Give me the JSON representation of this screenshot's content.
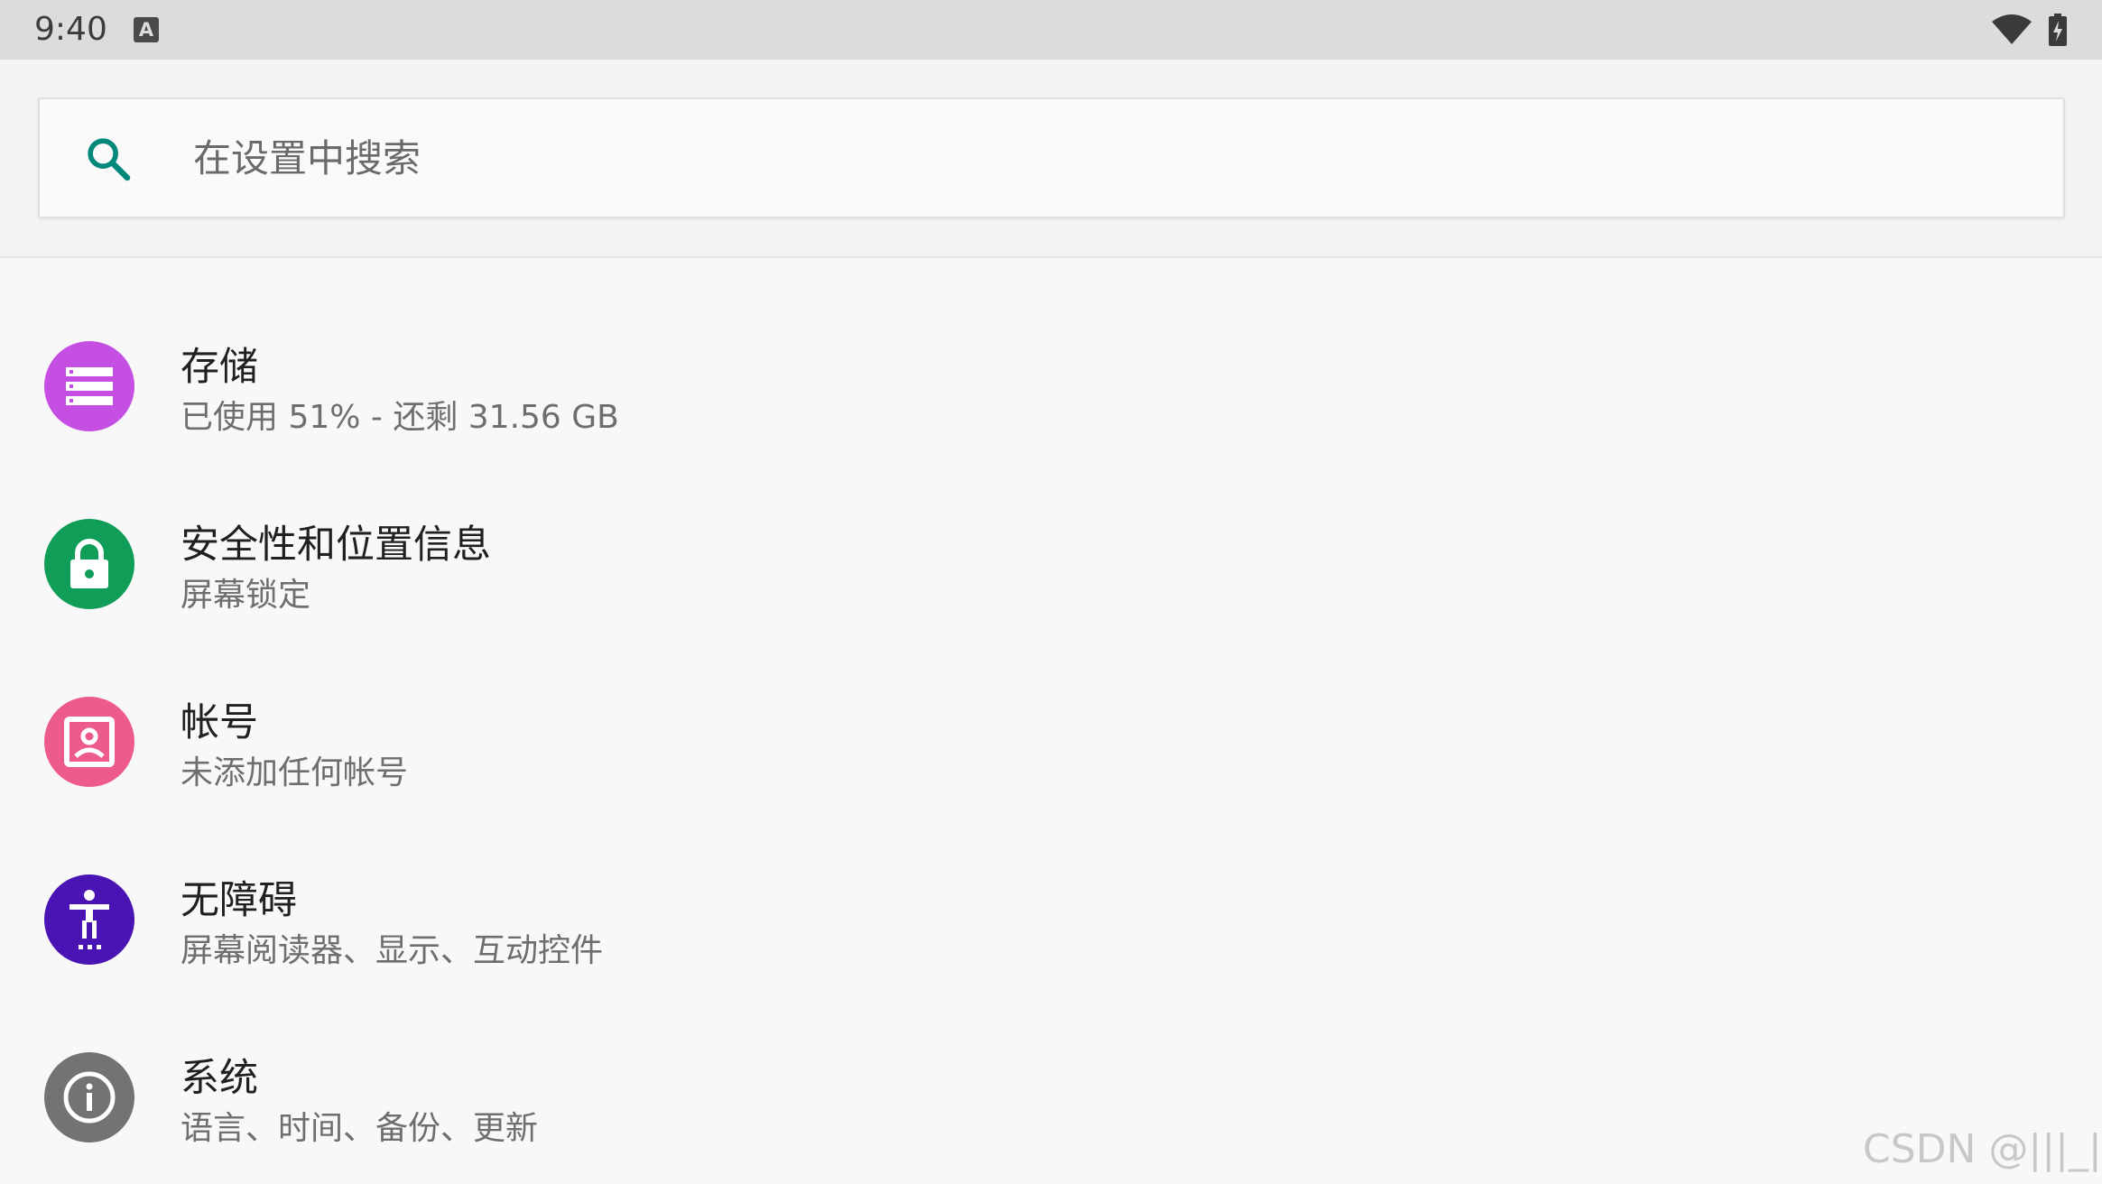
{
  "status_bar": {
    "time": "9:40",
    "notification_icon": "A",
    "icons": [
      "wifi-icon",
      "battery-charging-icon"
    ]
  },
  "search": {
    "placeholder": "在设置中搜索",
    "value": ""
  },
  "settings_items": [
    {
      "title": "存储",
      "subtitle": "已使用 51% - 还剩 31.56 GB",
      "icon": "storage-icon",
      "color": "#c54ee3"
    },
    {
      "title": "安全性和位置信息",
      "subtitle": "屏幕锁定",
      "icon": "lock-icon",
      "color": "#0f9d58"
    },
    {
      "title": "帐号",
      "subtitle": "未添加任何帐号",
      "icon": "account-icon",
      "color": "#ec5b8c"
    },
    {
      "title": "无障碍",
      "subtitle": "屏幕阅读器、显示、互动控件",
      "icon": "accessibility-icon",
      "color": "#4a13b3"
    },
    {
      "title": "系统",
      "subtitle": "语言、时间、备份、更新",
      "icon": "info-icon",
      "color": "#737373"
    }
  ],
  "colors": {
    "search_icon": "#00897b",
    "background": "#f8f8f8",
    "status_bar": "#dcdcdc"
  },
  "watermark": "CSDN @|||_|||"
}
